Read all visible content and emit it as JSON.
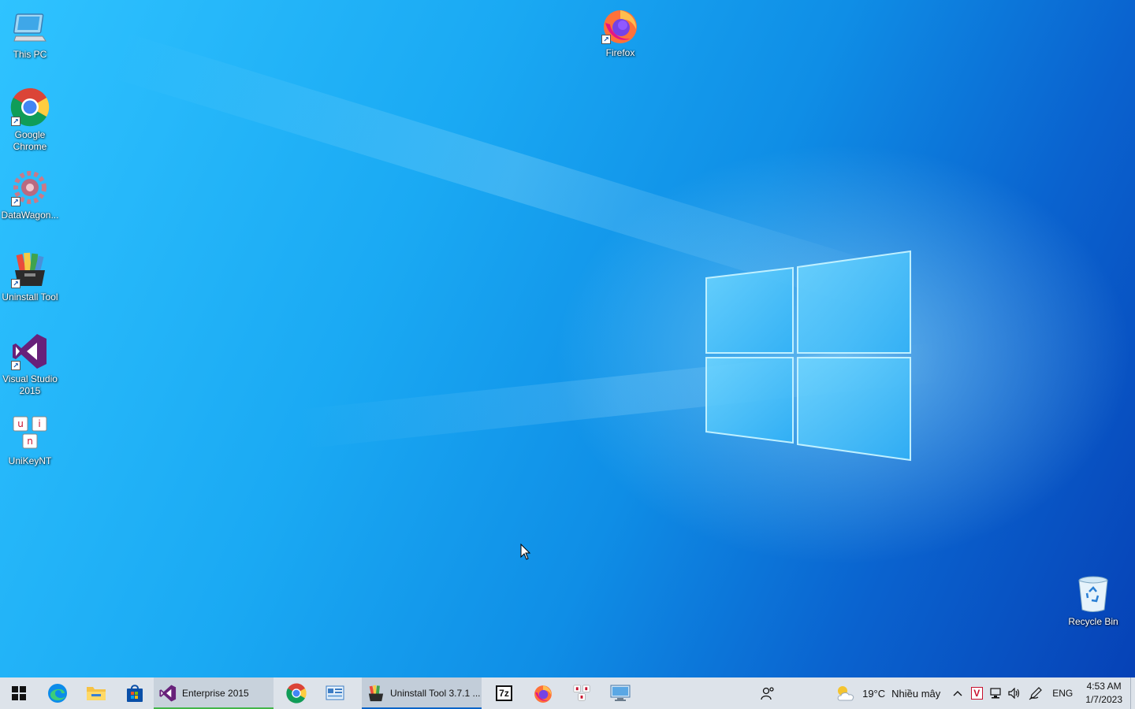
{
  "desktop": {
    "icons": [
      {
        "label": "This PC",
        "icon": "computer-icon"
      },
      {
        "label": "Google Chrome",
        "icon": "chrome-icon"
      },
      {
        "label": "DataWagon...",
        "icon": "gear-cluster-icon"
      },
      {
        "label": "Uninstall Tool",
        "icon": "uninstall-box-icon"
      },
      {
        "label": "Visual Studio 2015",
        "icon": "visual-studio-icon"
      },
      {
        "label": "UniKeyNT",
        "icon": "unikey-icon"
      },
      {
        "label": "Firefox",
        "icon": "firefox-icon"
      },
      {
        "label": "Recycle Bin",
        "icon": "recycle-bin-icon"
      }
    ],
    "unikey_letters": [
      "u",
      "i",
      "n"
    ]
  },
  "taskbar": {
    "start_icon": "windows-start-icon",
    "pinned": [
      {
        "name": "edge",
        "icon": "edge-icon"
      },
      {
        "name": "file-explorer",
        "icon": "folder-icon"
      },
      {
        "name": "store",
        "icon": "store-icon"
      }
    ],
    "vs_task_label": "Enterprise 2015",
    "uninstall_task_label": "Uninstall Tool 3.7.1 ...",
    "sevenzip_label": "7z",
    "people_icon": "people-icon"
  },
  "tray": {
    "weather_temp": "19°C",
    "weather_desc": "Nhiều mây",
    "language": "ENG",
    "time": "4:53 AM",
    "date": "1/7/2023",
    "unikey_mode": "V"
  },
  "colors": {
    "taskbar_bg": "#dde3ea",
    "active_underline": "#0a64c8",
    "vs_purple": "#68217a"
  }
}
